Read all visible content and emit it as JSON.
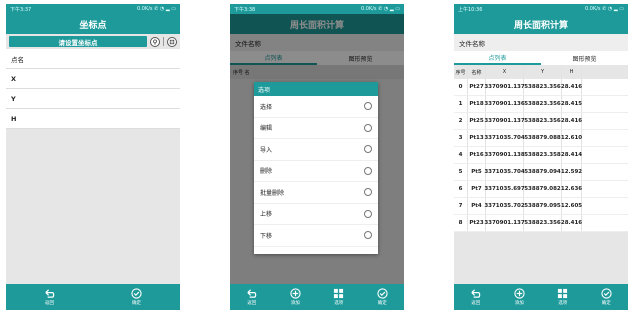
{
  "screen1": {
    "status_time": "下午3:37",
    "status_right": "0.0K/s ✆ ◔ ▂ ▭",
    "title": "坐标点",
    "set_button": "请设置坐标点",
    "fields": [
      "点名",
      "X",
      "Y",
      "H"
    ],
    "bottom": {
      "back": "返回",
      "confirm": "确定"
    }
  },
  "screen2": {
    "status_time": "下午3:38",
    "status_right": "0.0K/s ✆ ◔ ▂ ▭",
    "title": "周长面积计算",
    "file_label": "文件名称",
    "tabs": [
      "点列表",
      "图形预览"
    ],
    "table_head_partial": "序号 名",
    "dialog": {
      "title": "选项",
      "options": [
        "选择",
        "编辑",
        "导入",
        "删除",
        "批量删除",
        "上移",
        "下移"
      ]
    },
    "bottom": {
      "back": "返回",
      "add": "添加",
      "options": "选项",
      "confirm": "确定"
    }
  },
  "screen3": {
    "status_time": "上午10:36",
    "status_right": "0.0K/s ✆ ◔ ▂ ▭",
    "title": "周长面积计算",
    "file_label": "文件名称",
    "tabs": [
      "点列表",
      "图形预览"
    ],
    "columns": [
      "序号",
      "名称",
      "X",
      "Y",
      "H"
    ],
    "rows": [
      [
        "0",
        "Pt27",
        "3370901.137",
        "538823.356",
        "28.416"
      ],
      [
        "1",
        "Pt18",
        "3370901.136",
        "538823.356",
        "28.415"
      ],
      [
        "2",
        "Pt25",
        "3370901.137",
        "538823.356",
        "28.416"
      ],
      [
        "3",
        "Pt13",
        "3371035.704",
        "538879.088",
        "12.610"
      ],
      [
        "4",
        "Pt16",
        "3370901.138",
        "538823.358",
        "28.414"
      ],
      [
        "5",
        "Pt5",
        "3371035.704",
        "538879.094",
        "12.592"
      ],
      [
        "6",
        "Pt7",
        "3371035.697",
        "538879.082",
        "12.636"
      ],
      [
        "7",
        "Pt4",
        "3371035.702",
        "538879.095",
        "12.605"
      ],
      [
        "8",
        "Pt23",
        "3370901.137",
        "538823.356",
        "28.416"
      ]
    ],
    "bottom": {
      "back": "返回",
      "add": "添加",
      "options": "选项",
      "confirm": "确定"
    }
  },
  "colors": {
    "accent": "#1e9a9a"
  },
  "icons": [
    "back-icon",
    "add-icon",
    "grid-icon",
    "check-icon",
    "location-icon",
    "import-icon"
  ]
}
